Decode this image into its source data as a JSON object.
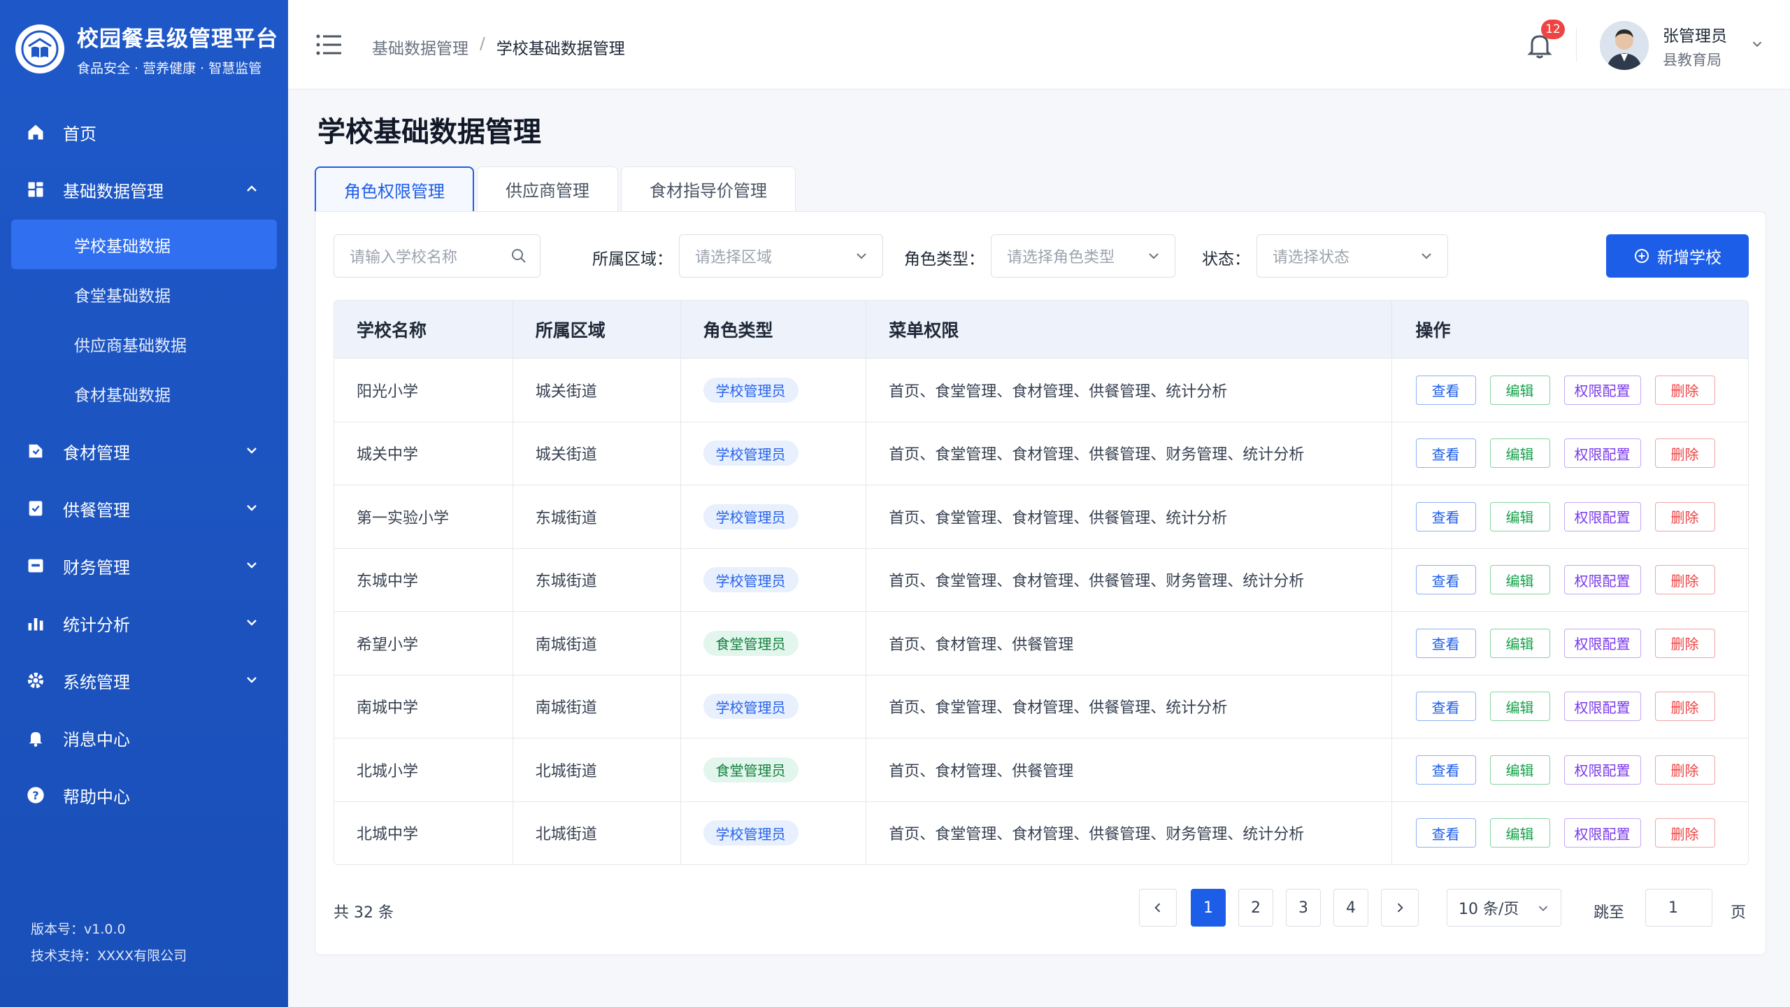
{
  "brand": {
    "title": "校园餐县级管理平台",
    "subtitle": "食品安全 · 营养健康 · 智慧监管"
  },
  "nav": [
    {
      "label": "首页",
      "icon": "home-icon"
    },
    {
      "label": "基础数据管理",
      "icon": "grid-icon",
      "expanded": true,
      "children": [
        "学校基础数据",
        "食堂基础数据",
        "供应商基础数据",
        "食材基础数据"
      ],
      "active_child": 0
    },
    {
      "label": "食材管理",
      "icon": "box-icon"
    },
    {
      "label": "供餐管理",
      "icon": "meal-icon"
    },
    {
      "label": "财务管理",
      "icon": "wallet-icon"
    },
    {
      "label": "统计分析",
      "icon": "chart-icon"
    },
    {
      "label": "系统管理",
      "icon": "gear-icon"
    },
    {
      "label": "消息中心",
      "icon": "bell-icon"
    },
    {
      "label": "帮助中心",
      "icon": "help-icon"
    }
  ],
  "footer": {
    "version": "版本号：v1.0.0",
    "support": "技术支持：XXXX有限公司"
  },
  "header": {
    "breadcrumb_parent": "基础数据管理",
    "breadcrumb_sep": "/",
    "breadcrumb_current": "学校基础数据管理",
    "notification_count": "12",
    "user_name": "张管理员",
    "user_org": "县教育局"
  },
  "page_title": "学校基础数据管理",
  "tabs": [
    "角色权限管理",
    "供应商管理",
    "食材指导价管理"
  ],
  "filters": {
    "search_placeholder": "请输入学校名称",
    "region_label": "所属区域：",
    "region_placeholder": "请选择区域",
    "role_label": "角色类型：",
    "role_placeholder": "请选择角色类型",
    "status_label": "状态：",
    "status_placeholder": "请选择状态",
    "add_button": "新增学校"
  },
  "table": {
    "headers": [
      "学校名称",
      "所属区域",
      "角色类型",
      "菜单权限",
      "操作"
    ],
    "actions": [
      "查看",
      "编辑",
      "权限配置",
      "删除"
    ],
    "rows": [
      {
        "name": "阳光小学",
        "region": "城关街道",
        "role": "学校管理员",
        "menu": "首页、食堂管理、食材管理、供餐管理、统计分析"
      },
      {
        "name": "城关中学",
        "region": "城关街道",
        "role": "学校管理员",
        "menu": "首页、食堂管理、食材管理、供餐管理、财务管理、统计分析"
      },
      {
        "name": "第一实验小学",
        "region": "东城街道",
        "role": "学校管理员",
        "menu": "首页、食堂管理、食材管理、供餐管理、统计分析"
      },
      {
        "name": "东城中学",
        "region": "东城街道",
        "role": "学校管理员",
        "menu": "首页、食堂管理、食材管理、供餐管理、财务管理、统计分析"
      },
      {
        "name": "希望小学",
        "region": "南城街道",
        "role": "食堂管理员",
        "menu": "首页、食材管理、供餐管理"
      },
      {
        "name": "南城中学",
        "region": "南城街道",
        "role": "学校管理员",
        "menu": "首页、食堂管理、食材管理、供餐管理、统计分析"
      },
      {
        "name": "北城小学",
        "region": "北城街道",
        "role": "食堂管理员",
        "menu": "首页、食材管理、供餐管理"
      },
      {
        "name": "北城中学",
        "region": "北城街道",
        "role": "学校管理员",
        "menu": "首页、食堂管理、食材管理、供餐管理、财务管理、统计分析"
      }
    ]
  },
  "pagination": {
    "total": "共 32 条",
    "pages": [
      "1",
      "2",
      "3",
      "4"
    ],
    "current": "1",
    "page_size": "10 条/页",
    "jump_label": "跳至",
    "jump_value": "1",
    "page_suffix": "页"
  },
  "colors": {
    "primary": "#1d5ee8",
    "sidebar": "#1e58c8",
    "danger": "#ef4444",
    "success": "#16a34a",
    "purple": "#7c3aed"
  }
}
